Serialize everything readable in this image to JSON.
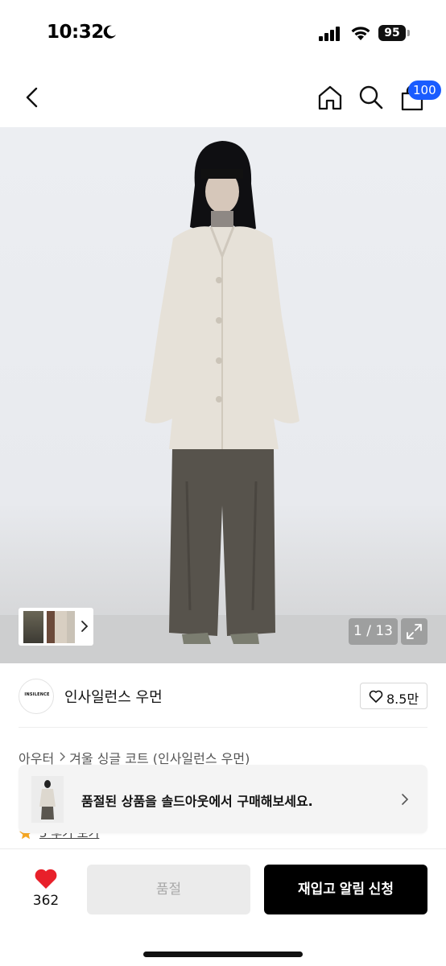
{
  "status_bar": {
    "time": "10:32",
    "battery_level": "95",
    "icons": [
      "moon-icon",
      "signal-icon",
      "wifi-icon",
      "battery-icon"
    ]
  },
  "nav": {
    "icons": [
      "back-icon",
      "home-icon",
      "search-icon",
      "bag-icon"
    ],
    "bag_badge": "100",
    "badge_color": "#1a5cff"
  },
  "gallery": {
    "counter": "1 / 13",
    "icons": [
      "chevron-right-icon",
      "expand-icon"
    ]
  },
  "brand": {
    "logo_text": "INSILENCE",
    "name": "인사일런스 우먼",
    "like_count": "8.5만"
  },
  "breadcrumb": {
    "category": "아우터",
    "product": "겨울 싱글 코트 (인사일런스 우먼)"
  },
  "peek_row": {
    "rating": "5",
    "text": "후기 보기"
  },
  "soldout_banner": {
    "text": "품절된 상품을 솔드아웃에서 구매해보세요."
  },
  "bottom_bar": {
    "wish_count": "362",
    "soldout_label": "품절",
    "restock_label": "재입고 알림 신청",
    "heart_color": "#e8202a"
  }
}
